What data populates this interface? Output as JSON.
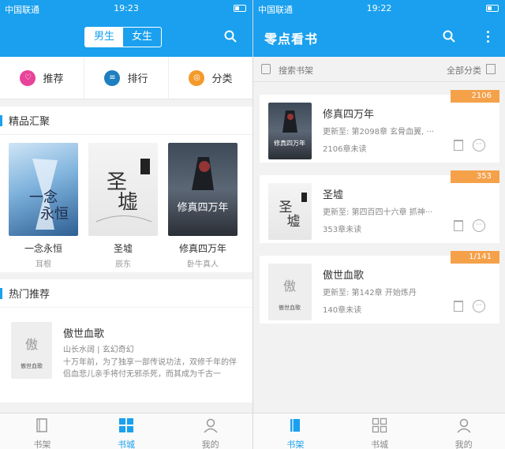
{
  "left": {
    "status": {
      "carrier": "中国联通",
      "time": "19:23"
    },
    "gender_tabs": [
      "男生",
      "女生"
    ],
    "quicknav": [
      {
        "label": "推荐",
        "icon": "recommend-icon",
        "color": "#e8439a",
        "glyph": "♡"
      },
      {
        "label": "排行",
        "icon": "ranking-icon",
        "color": "#1e7fc0",
        "glyph": "≡"
      },
      {
        "label": "分类",
        "icon": "category-icon",
        "color": "#f39a2b",
        "glyph": "◎"
      }
    ],
    "featured": {
      "title": "精品汇聚",
      "books": [
        {
          "name": "一念永恒",
          "author": "耳根",
          "cover_text": "一念永恒"
        },
        {
          "name": "圣墟",
          "author": "辰东",
          "cover_text": "圣墟"
        },
        {
          "name": "修真四万年",
          "author": "卧牛真人",
          "cover_text": "修真四万年"
        }
      ]
    },
    "hot": {
      "title": "热门推荐",
      "book": {
        "name": "傲世血歌",
        "meta": "山长水阔 | 玄幻奇幻",
        "desc": "十万年前，为了独享一部传说功法，双修千年的伴侣血悲儿亲手将付无邪杀死，而其成为千古一",
        "cover_text": "傲世血歌"
      }
    },
    "tabs": [
      {
        "label": "书架",
        "icon": "bookshelf-icon"
      },
      {
        "label": "书城",
        "icon": "bookstore-icon"
      },
      {
        "label": "我的",
        "icon": "profile-icon"
      }
    ]
  },
  "right": {
    "status": {
      "carrier": "中国联通",
      "time": "19:22"
    },
    "title": "零点看书",
    "search_placeholder": "搜索书架",
    "all_categories": "全部分类",
    "books": [
      {
        "name": "修真四万年",
        "update": "更新至: 第2098章 玄骨血翼, ···",
        "unread": "2106章未读",
        "badge": "2106",
        "cover_text": "修真四万年"
      },
      {
        "name": "圣墟",
        "update": "更新至: 第四百四十六章 抓神···",
        "unread": "353章未读",
        "badge": "353",
        "cover_text": "圣墟"
      },
      {
        "name": "傲世血歌",
        "update": "更新至: 第142章 开始炼丹",
        "unread": "140章未读",
        "badge": "1/141",
        "cover_text": "傲世血歌"
      }
    ],
    "tabs": [
      {
        "label": "书架",
        "icon": "bookshelf-icon"
      },
      {
        "label": "书城",
        "icon": "bookstore-icon"
      },
      {
        "label": "我的",
        "icon": "profile-icon"
      }
    ]
  },
  "colors": {
    "primary": "#1aa0ee",
    "badge": "#f5a14a"
  }
}
